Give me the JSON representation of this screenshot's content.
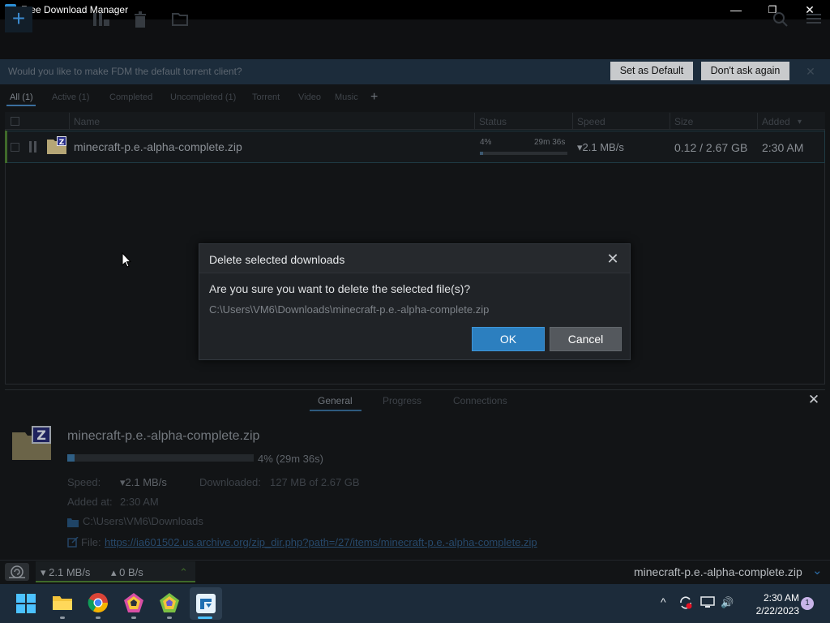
{
  "window": {
    "title": "Free Download Manager",
    "minimize": "—",
    "maximize": "❐",
    "close": "✕"
  },
  "toolbar": {
    "add": "+"
  },
  "banner": {
    "text": "Would you like to make FDM the default torrent client?",
    "set_default": "Set as Default",
    "dont_ask": "Don't ask again",
    "close": "✕"
  },
  "filters": {
    "tabs": [
      "All (1)",
      "Active (1)",
      "Completed",
      "Uncompleted (1)",
      "Torrent",
      "Video",
      "Music"
    ],
    "add": "+"
  },
  "list": {
    "columns": {
      "name": "Name",
      "status": "Status",
      "speed": "Speed",
      "size": "Size",
      "added": "Added",
      "added_sort": "▾"
    },
    "rows": [
      {
        "name": "minecraft-p.e.-alpha-complete.zip",
        "percent_label": "4%",
        "percent": 4,
        "eta": "29m 36s",
        "speed": "▾2.1 MB/s",
        "size": "0.12 / 2.67 GB",
        "added": "2:30 AM"
      }
    ]
  },
  "dialog": {
    "title": "Delete selected downloads",
    "close": "✕",
    "question": "Are you sure you want to delete the selected file(s)?",
    "path": "C:\\Users\\VM6\\Downloads\\minecraft-p.e.-alpha-complete.zip",
    "ok": "OK",
    "cancel": "Cancel"
  },
  "details": {
    "tabs": [
      "General",
      "Progress",
      "Connections"
    ],
    "close": "✕",
    "filename": "minecraft-p.e.-alpha-complete.zip",
    "progress_text": "4% (29m 36s)",
    "percent": 4,
    "speed_label": "Speed:",
    "speed_value": "▾2.1 MB/s",
    "downloaded_label": "Downloaded:",
    "downloaded_value": "127 MB of 2.67 GB",
    "added_label": "Added at:",
    "added_value": "2:30 AM",
    "folder": "C:\\Users\\VM6\\Downloads",
    "file_label": "File:",
    "file_url": "https://ia601502.us.archive.org/zip_dir.php?path=/27/items/minecraft-p.e.-alpha-complete.zip"
  },
  "statusbar": {
    "down_speed": "▾ 2.1 MB/s",
    "up_speed": "▴ 0 B/s",
    "expand": "⌃",
    "current_file": "minecraft-p.e.-alpha-complete.zip",
    "collapse": "⌄"
  },
  "taskbar": {
    "time": "2:30 AM",
    "date": "2/22/2023",
    "notifications": "1",
    "chevron": "^",
    "volume": "🔊"
  }
}
